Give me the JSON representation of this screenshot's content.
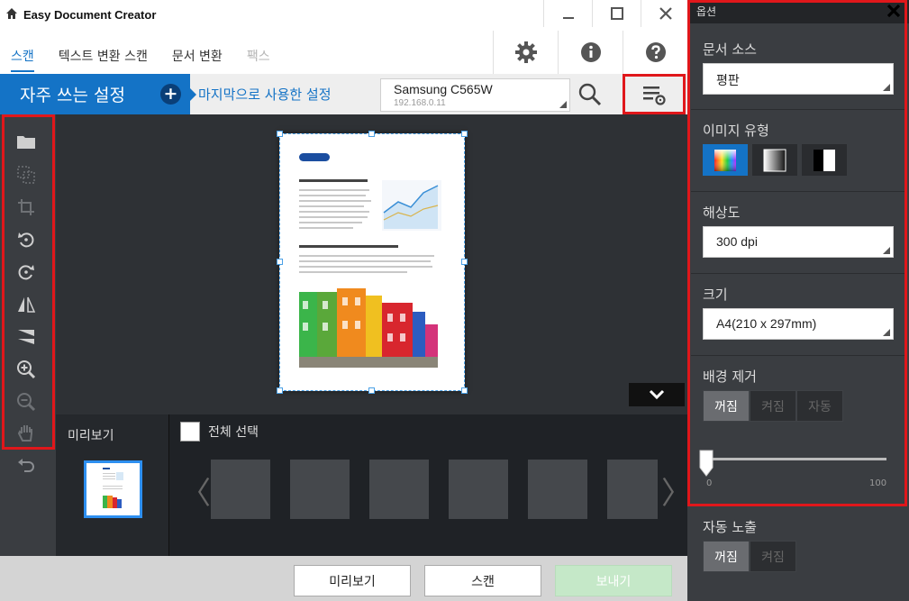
{
  "app": {
    "title": "Easy Document Creator"
  },
  "menu": {
    "tabs": [
      {
        "label": "스캔"
      },
      {
        "label": "텍스트 변환 스캔"
      },
      {
        "label": "문서 변환"
      },
      {
        "label": "팩스"
      }
    ]
  },
  "setbar": {
    "favorites_label": "자주 쓰는 설정",
    "add_symbol": "+",
    "last_used_label": "마지막으로 사용한 설정",
    "device_name": "Samsung C565W",
    "device_ip": "192.168.0.11"
  },
  "bottom": {
    "preview_label": "미리보기",
    "select_all_label": "전체 선택",
    "prev_arrow": "〈",
    "next_arrow": "〉"
  },
  "footer": {
    "preview_button": "미리보기",
    "scan_button": "스캔",
    "send_button": "보내기"
  },
  "options": {
    "header": "옵션",
    "doc_source": {
      "title": "문서 소스",
      "value": "평판"
    },
    "image_type": {
      "title": "이미지 유형"
    },
    "resolution": {
      "title": "해상도",
      "value": "300 dpi"
    },
    "size": {
      "title": "크기",
      "value": "A4(210 x 297mm)"
    },
    "bg_removal": {
      "title": "배경 제거",
      "options": [
        "꺼짐",
        "켜짐",
        "자동"
      ],
      "selected": "꺼짐",
      "slider_value": 0,
      "slider_min": "0",
      "slider_max": "100"
    },
    "auto_exposure": {
      "title": "자동 노출",
      "options": [
        "꺼짐",
        "켜짐"
      ],
      "selected": "꺼짐"
    }
  },
  "colors": {
    "accent": "#1473c6",
    "highlight": "#e0171b",
    "dark_panel": "#3a3d41"
  }
}
